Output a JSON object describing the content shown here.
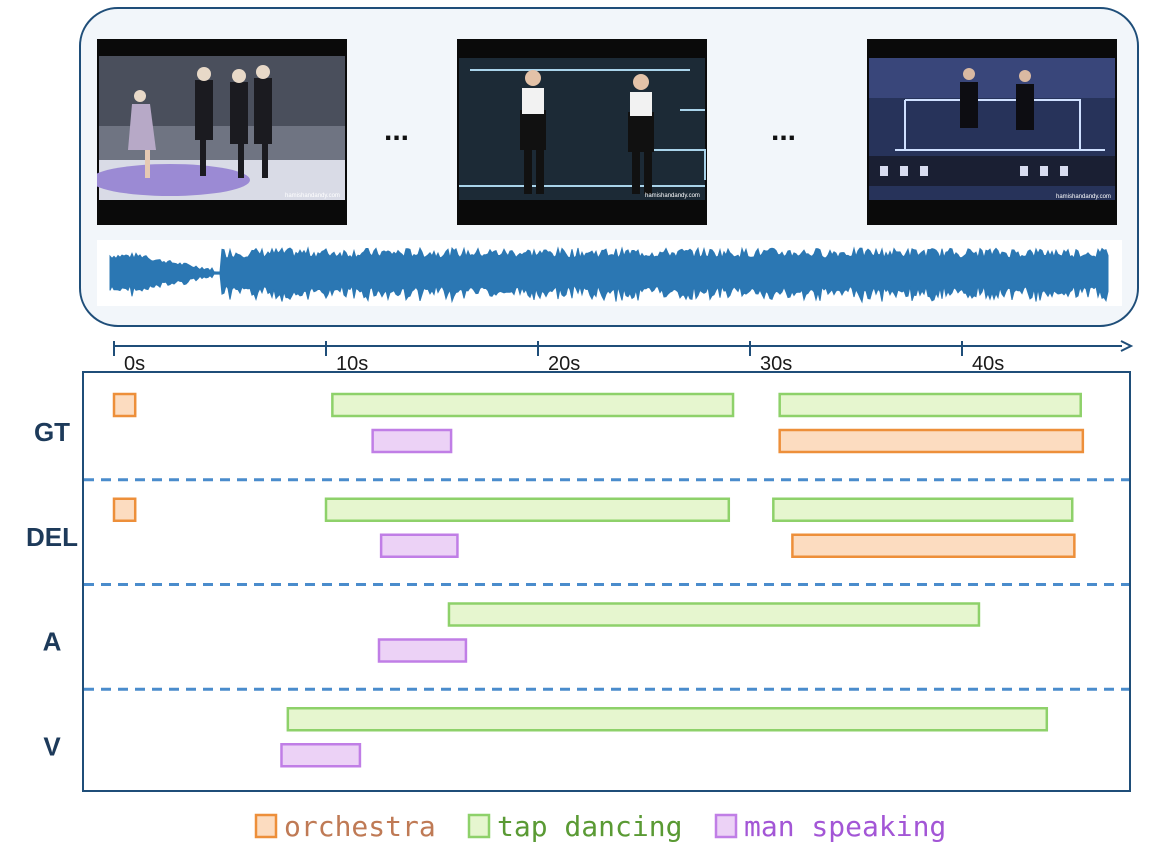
{
  "colors": {
    "panel_border": "#1f4e79",
    "panel_bg": "#f2f6fa",
    "waveform": "#2b77b3",
    "axis": "#1f4e79",
    "separator": "#4a8ccc",
    "row_label": "#1d3a5a"
  },
  "video_panel": {
    "frames": [
      {
        "name": "frame-start",
        "watermark": "hamishandandy.com"
      },
      {
        "name": "frame-middle",
        "watermark": "hamishandandy.com"
      },
      {
        "name": "frame-end",
        "watermark": "hamishandandy.com"
      }
    ],
    "ellipsis": "..."
  },
  "timeline": {
    "tick_labels": [
      "0s",
      "10s",
      "20s",
      "30s",
      "40s"
    ],
    "ticks_seconds": [
      0,
      10,
      20,
      30,
      40
    ],
    "range_seconds": [
      0,
      47
    ]
  },
  "categories": [
    {
      "key": "orchestra",
      "label": "orchestra",
      "fill": "#fcdcc0",
      "stroke": "#ed8f3a",
      "text": "#bf7a55"
    },
    {
      "key": "tap",
      "label": "tap dancing",
      "fill": "#e6f6cf",
      "stroke": "#8ed16a",
      "text": "#5a9a34"
    },
    {
      "key": "speech",
      "label": "man speaking",
      "fill": "#ecd2f6",
      "stroke": "#c07ee6",
      "text": "#a356d6"
    }
  ],
  "rows": [
    {
      "label": "GT",
      "segments": [
        {
          "cat": "orchestra",
          "start": 0,
          "end": 1.0,
          "lane": 0
        },
        {
          "cat": "tap",
          "start": 10.3,
          "end": 29.2,
          "lane": 0
        },
        {
          "cat": "tap",
          "start": 31.4,
          "end": 45.6,
          "lane": 0
        },
        {
          "cat": "speech",
          "start": 12.2,
          "end": 15.9,
          "lane": 1
        },
        {
          "cat": "orchestra",
          "start": 31.4,
          "end": 45.7,
          "lane": 1
        }
      ]
    },
    {
      "label": "DEL",
      "segments": [
        {
          "cat": "orchestra",
          "start": 0,
          "end": 1.0,
          "lane": 0
        },
        {
          "cat": "tap",
          "start": 10.0,
          "end": 29.0,
          "lane": 0
        },
        {
          "cat": "tap",
          "start": 31.1,
          "end": 45.2,
          "lane": 0
        },
        {
          "cat": "speech",
          "start": 12.6,
          "end": 16.2,
          "lane": 1
        },
        {
          "cat": "orchestra",
          "start": 32.0,
          "end": 45.3,
          "lane": 1
        }
      ]
    },
    {
      "label": "A",
      "segments": [
        {
          "cat": "tap",
          "start": 15.8,
          "end": 40.8,
          "lane": 0
        },
        {
          "cat": "speech",
          "start": 12.5,
          "end": 16.6,
          "lane": 1
        }
      ]
    },
    {
      "label": "V",
      "segments": [
        {
          "cat": "tap",
          "start": 8.2,
          "end": 44.0,
          "lane": 0
        },
        {
          "cat": "speech",
          "start": 7.9,
          "end": 11.6,
          "lane": 1
        }
      ]
    }
  ]
}
